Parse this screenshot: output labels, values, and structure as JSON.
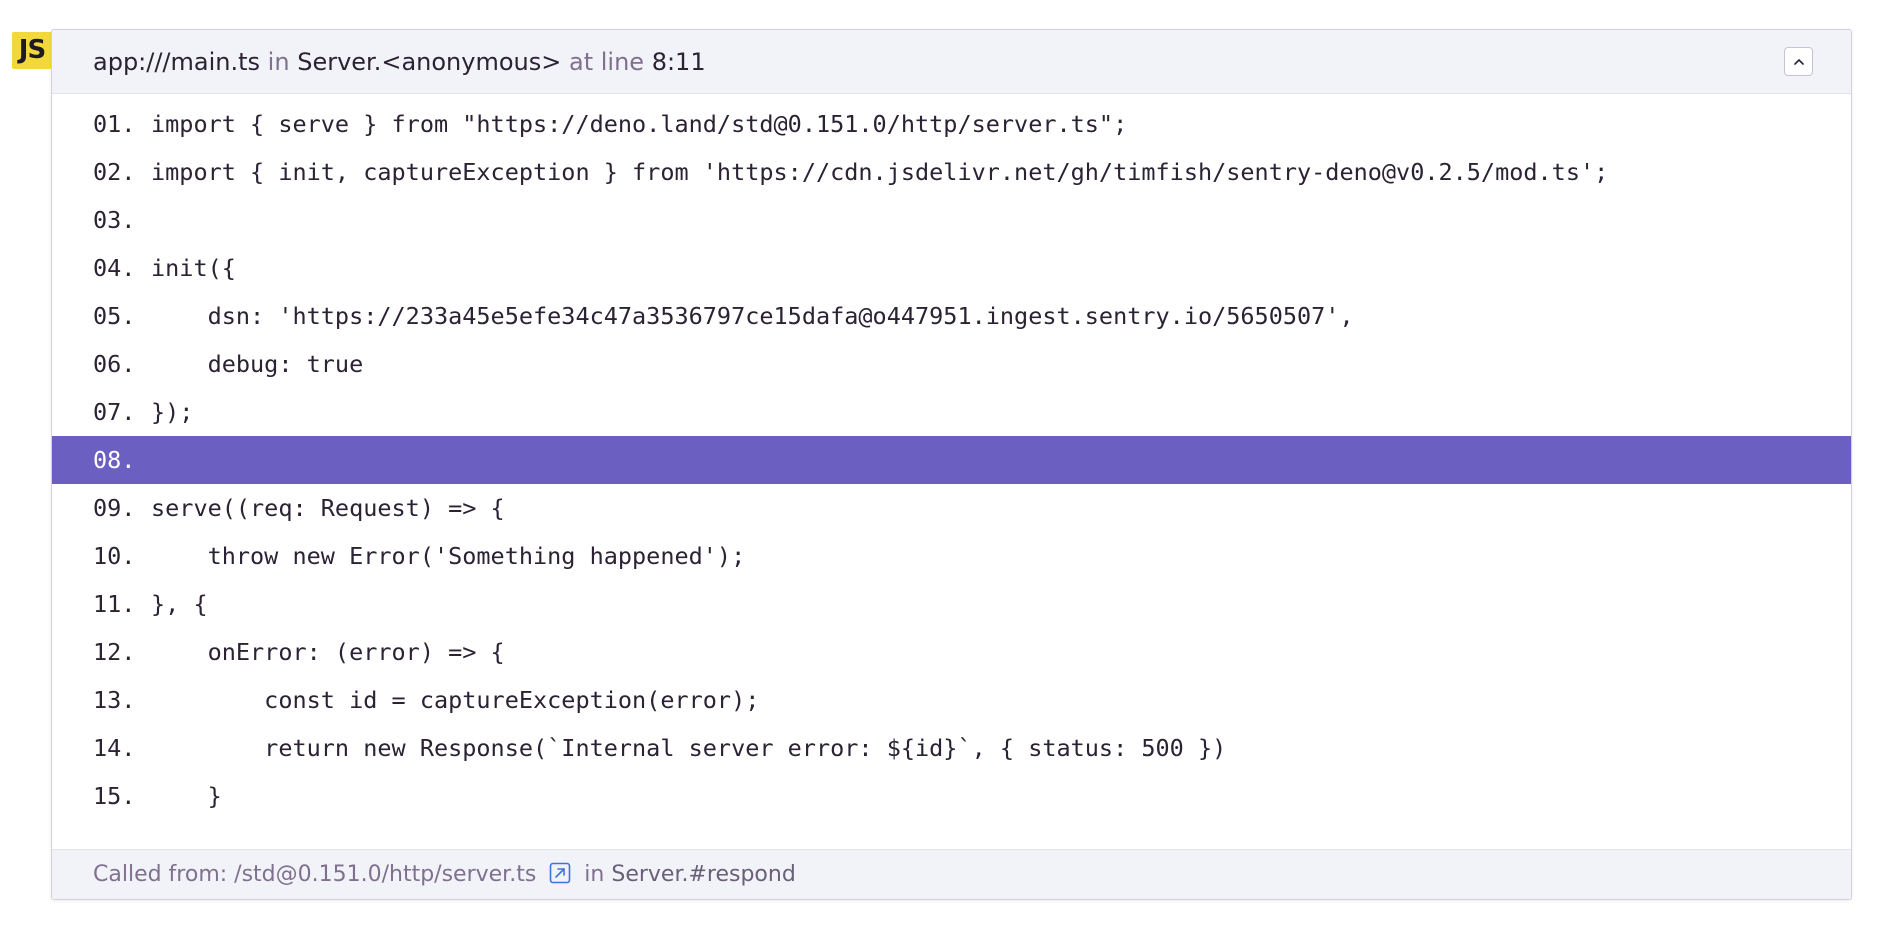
{
  "platform_badge": "JS",
  "header": {
    "filename": "app:///main.ts",
    "in_word": "in",
    "function": "Server.<anonymous>",
    "at_line_word": "at line",
    "location": "8:11",
    "collapse_icon": "chevron-up-icon"
  },
  "code": {
    "lines": [
      {
        "number": "01.",
        "text": "import { serve } from \"https://deno.land/std@0.151.0/http/server.ts\";"
      },
      {
        "number": "02.",
        "text": "import { init, captureException } from 'https://cdn.jsdelivr.net/gh/timfish/sentry-deno@v0.2.5/mod.ts';"
      },
      {
        "number": "03.",
        "text": ""
      },
      {
        "number": "04.",
        "text": "init({"
      },
      {
        "number": "05.",
        "text": "    dsn: 'https://233a45e5efe34c47a3536797ce15dafa@o447951.ingest.sentry.io/5650507',"
      },
      {
        "number": "06.",
        "text": "    debug: true"
      },
      {
        "number": "07.",
        "text": "});"
      },
      {
        "number": "08.",
        "text": ""
      },
      {
        "number": "09.",
        "text": "serve((req: Request) => {"
      },
      {
        "number": "10.",
        "text": "    throw new Error('Something happened');"
      },
      {
        "number": "11.",
        "text": "}, {"
      },
      {
        "number": "12.",
        "text": "    onError: (error) => {"
      },
      {
        "number": "13.",
        "text": "        const id = captureException(error);"
      },
      {
        "number": "14.",
        "text": "        return new Response(`Internal server error: ${id}`, { status: 500 })"
      },
      {
        "number": "15.",
        "text": "    }"
      }
    ],
    "active_line": "08.",
    "active_color": "#6c5fc2"
  },
  "footer": {
    "called_from_label": "Called from: /std@0.151.0/http/server.ts",
    "link_icon": "external-link-icon",
    "in_word": "in",
    "function": "Server.#respond"
  },
  "colors": {
    "badge": "#f3d83b",
    "header_bg": "#f2f3f8",
    "link_icon": "#3d74db"
  }
}
